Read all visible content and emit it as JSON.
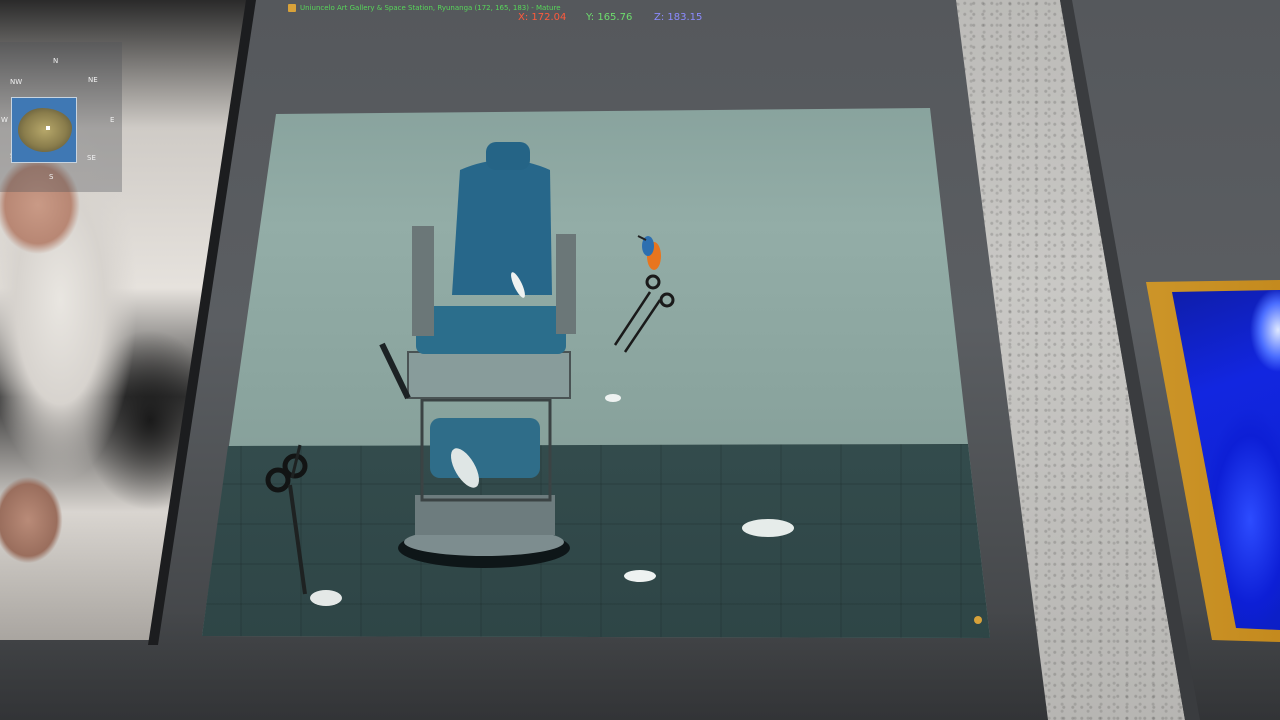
{
  "hud": {
    "location": "Uniuncelo Art Gallery & Space Station, Ryunanga (172, 165, 183) - Mature",
    "x_label": "X: 172.04",
    "y_label": "Y: 165.76",
    "z_label": "Z: 183.15"
  },
  "minimap": {
    "compass": {
      "n": "N",
      "ne": "NE",
      "e": "E",
      "se": "SE",
      "s": "S",
      "sw": "SW",
      "w": "W",
      "nw": "NW"
    }
  },
  "colors": {
    "coord_x": "#ff5a3c",
    "coord_y": "#6ddc6d",
    "coord_z": "#8b8bff",
    "location_text": "#57d65a",
    "chair_blue": "#2b6e8c",
    "gold_frame": "#e8b23a"
  },
  "icons": {
    "parcel": "house-icon",
    "avatar": "avatar-dot-icon"
  }
}
